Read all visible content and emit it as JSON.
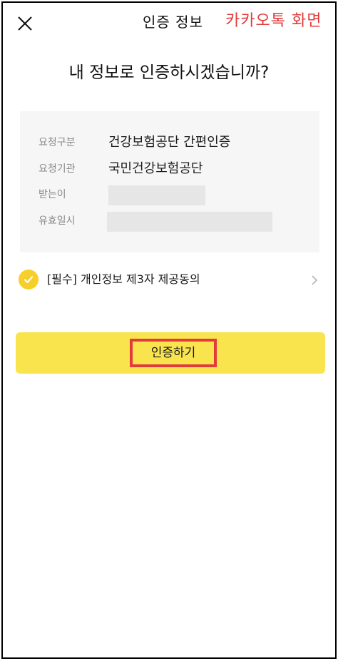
{
  "header": {
    "title": "인증 정보",
    "annotation": "카카오톡 화면"
  },
  "question": "내 정보로 인증하시겠습니까?",
  "info": {
    "rows": [
      {
        "label": "요청구분",
        "value": "건강보험공단 간편인증"
      },
      {
        "label": "요청기관",
        "value": "국민건강보험공단"
      },
      {
        "label": "받는이",
        "value": ""
      },
      {
        "label": "유효일시",
        "value": ""
      }
    ]
  },
  "consent": {
    "text": "[필수] 개인정보 제3자 제공동의",
    "checked": true
  },
  "auth_button": {
    "label": "인증하기"
  },
  "colors": {
    "accent_yellow": "#f9e44e",
    "check_yellow": "#f7cf2a",
    "annotation_red": "#e03c3c",
    "card_bg": "#f6f6f6"
  },
  "icons": {
    "close": "close-icon",
    "check": "check-icon",
    "chevron": "chevron-right-icon"
  }
}
